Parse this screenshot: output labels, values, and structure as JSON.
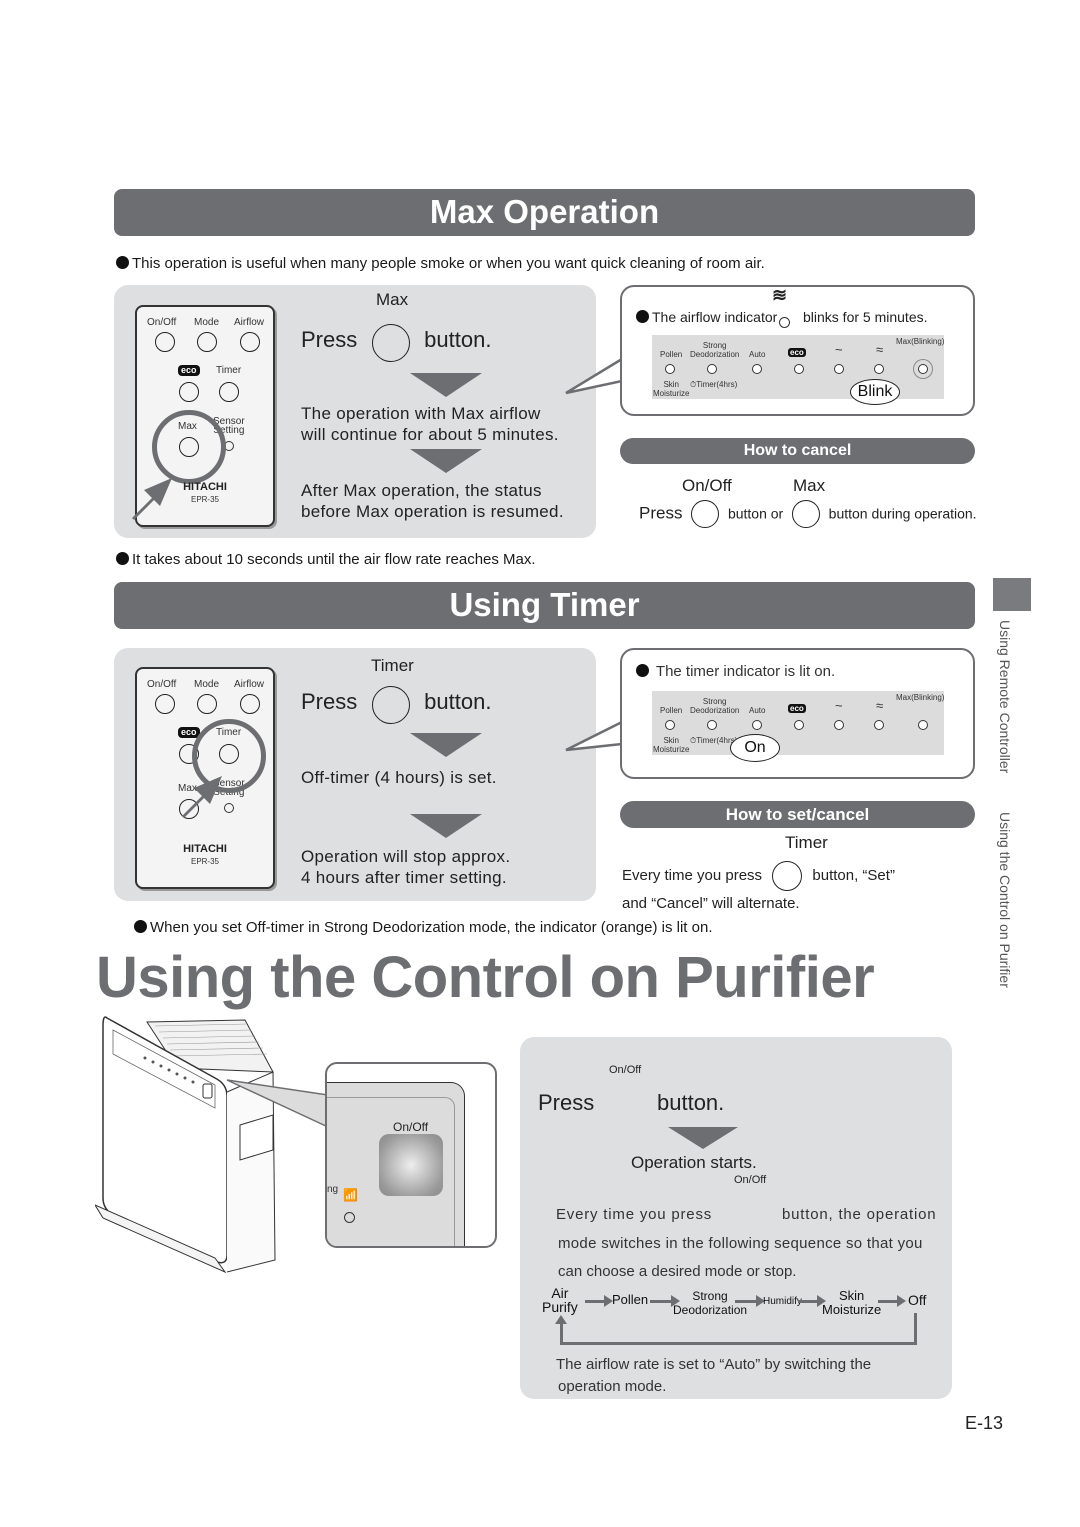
{
  "max_operation": {
    "title": "Max Operation",
    "intro_note": "This operation is useful when many people smoke or when you want quick cleaning of room air.",
    "remote": {
      "buttons_row1": [
        "On/Off",
        "Mode",
        "Airflow"
      ],
      "eco_label": "eco",
      "timer_label": "Timer",
      "max_label": "Max",
      "sensor_label_1": "Sensor",
      "sensor_label_2": "Setting",
      "brand": "HITACHI",
      "model": "EPR-35"
    },
    "button_label": "Max",
    "press_label": "Press",
    "button_word": "button.",
    "step1": [
      "The operation with Max airflow",
      "will continue for about 5 minutes."
    ],
    "step2": [
      "After Max operation, the status",
      "before Max operation is resumed."
    ],
    "callout_text_1": "The airflow indicator",
    "callout_text_2": "blinks for 5 minutes.",
    "indicator_panel": {
      "labels": [
        "Pollen",
        "Strong\nDeodorization",
        "Auto",
        "eco",
        "~",
        "≈",
        "Max(Blinking)"
      ],
      "bottom_labels": [
        "Skin\nMoisturize",
        "Timer(4hrs)"
      ],
      "bubble": "Blink"
    },
    "how_to_cancel": {
      "title": "How to cancel",
      "label_onoff": "On/Off",
      "label_max": "Max",
      "press": "Press",
      "button_or": "button or",
      "button_during": "button during operation."
    },
    "footer_note": "It takes about 10 seconds until the air flow rate reaches Max."
  },
  "using_timer": {
    "title": "Using Timer",
    "button_label": "Timer",
    "press_label": "Press",
    "button_word": "button.",
    "step1": "Off-timer (4 hours) is set.",
    "step2": [
      "Operation will stop approx.",
      "4 hours after timer setting."
    ],
    "callout_text": "The timer indicator is lit on.",
    "indicator_panel": {
      "labels": [
        "Pollen",
        "Strong\nDeodorization",
        "Auto",
        "eco",
        "~",
        "≈",
        "Max(Blinking)"
      ],
      "bottom_labels": [
        "Skin\nMoisturize",
        "Timer(4hrs)"
      ],
      "bubble": "On"
    },
    "how_to_set": {
      "title": "How to set/cancel",
      "label_timer": "Timer",
      "line1_a": "Every time you press",
      "line1_b": "button, “Set”",
      "line2": "and “Cancel” will alternate."
    },
    "footer_note": "When you set Off-timer in Strong Deodorization mode, the indicator (orange) is lit on."
  },
  "control_on_purifier": {
    "title": "Using the Control on Purifier",
    "closeup_label": "On/Off",
    "closeup_partial": "ng",
    "panel": {
      "onoff_top": "On/Off",
      "press": "Press",
      "button_word": "button.",
      "result": "Operation starts.",
      "onoff_small": "On/Off",
      "desc_a": "Every time you press",
      "desc_b": "button, the operation",
      "desc_2": "mode switches in the following sequence so that you",
      "desc_3": "can choose a desired mode or stop.",
      "sequence": [
        "Air\nPurify",
        "Pollen",
        "Strong\nDeodorization",
        "Humidify",
        "Skin\nMoisturize",
        "Off"
      ],
      "footer": [
        "The airflow rate is set to “Auto” by switching the",
        "operation mode."
      ]
    }
  },
  "side_tab": {
    "text_1": "Using Remote Controller",
    "text_2": "Using the Control on Purifier"
  },
  "page_number": "E-13",
  "colors": {
    "section_gray": "#6d6e71",
    "panel_gray": "#dedfe1",
    "text": "#222222"
  }
}
